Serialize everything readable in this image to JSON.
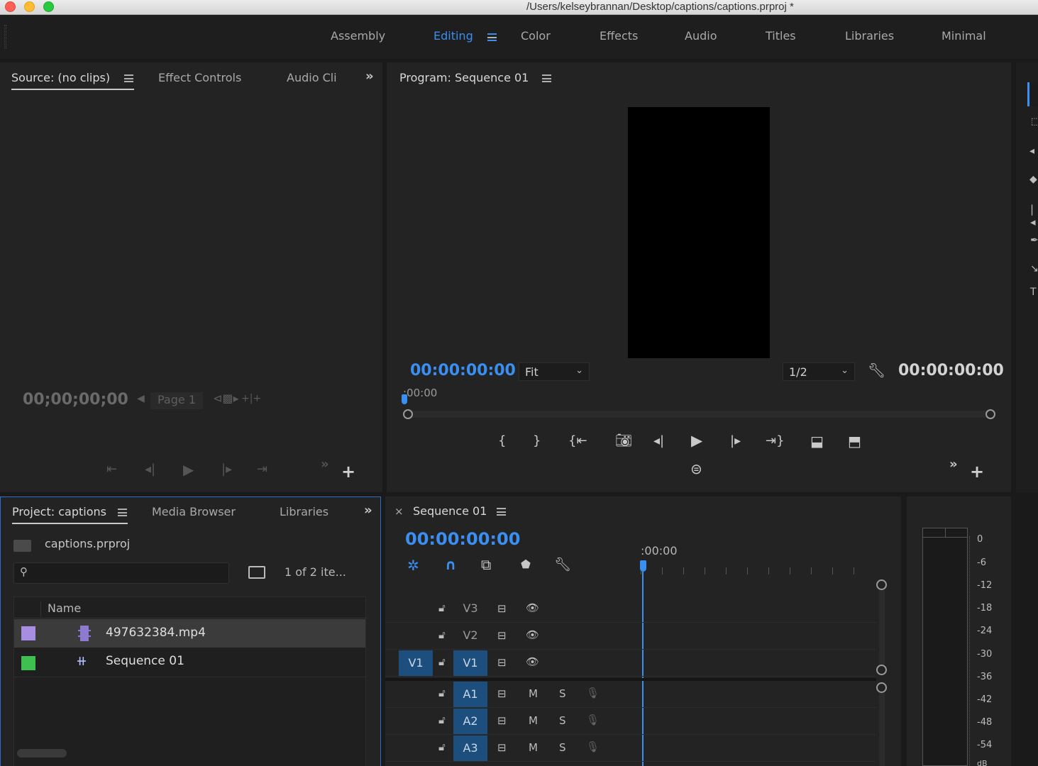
{
  "window": {
    "title": "/Users/kelseybrannan/Desktop/captions/captions.prproj *",
    "traffic_lights": [
      "#fe5f57",
      "#febc2e",
      "#28c840"
    ]
  },
  "workspaces": {
    "items": [
      "Assembly",
      "Editing",
      "Color",
      "Effects",
      "Audio",
      "Titles",
      "Libraries",
      "Minimal"
    ],
    "active": "Editing"
  },
  "source_panel": {
    "tabs": [
      "Source: (no clips)",
      "Effect Controls",
      "Audio Cli"
    ],
    "timecode": "00;00;00;00",
    "page_label": "Page 1"
  },
  "program_panel": {
    "title": "Program: Sequence 01",
    "timecode_left": "00:00:00:00",
    "fit_value": "Fit",
    "resolution_value": "1/2",
    "timecode_right": "00:00:00:00",
    "ruler_label": ":00:00"
  },
  "project_panel": {
    "tabs": [
      "Project: captions",
      "Media Browser",
      "Libraries"
    ],
    "project_file": "captions.prproj",
    "search_placeholder": "",
    "item_count": "1 of 2 ite...",
    "column_name": "Name",
    "items": [
      {
        "name": "497632384.mp4",
        "color": "#a88ee3"
      },
      {
        "name": "Sequence 01",
        "color": "#3fbf4f"
      }
    ]
  },
  "timeline": {
    "tab_title": "Sequence 01",
    "timecode": "00:00:00:00",
    "ruler_label": ":00:00",
    "video_tracks": [
      "V3",
      "V2",
      "V1"
    ],
    "audio_tracks": [
      "A1",
      "A2",
      "A3"
    ],
    "source_patch": "V1",
    "mute_label": "M",
    "solo_label": "S"
  },
  "audio_meter": {
    "labels": [
      "0",
      "-6",
      "-12",
      "-18",
      "-24",
      "-30",
      "-36",
      "-42",
      "-48",
      "-54",
      "dB"
    ]
  },
  "colors": {
    "accent_blue": "#3a8ff2",
    "panel_bg": "#232323",
    "track_active": "#1d4f7e"
  }
}
